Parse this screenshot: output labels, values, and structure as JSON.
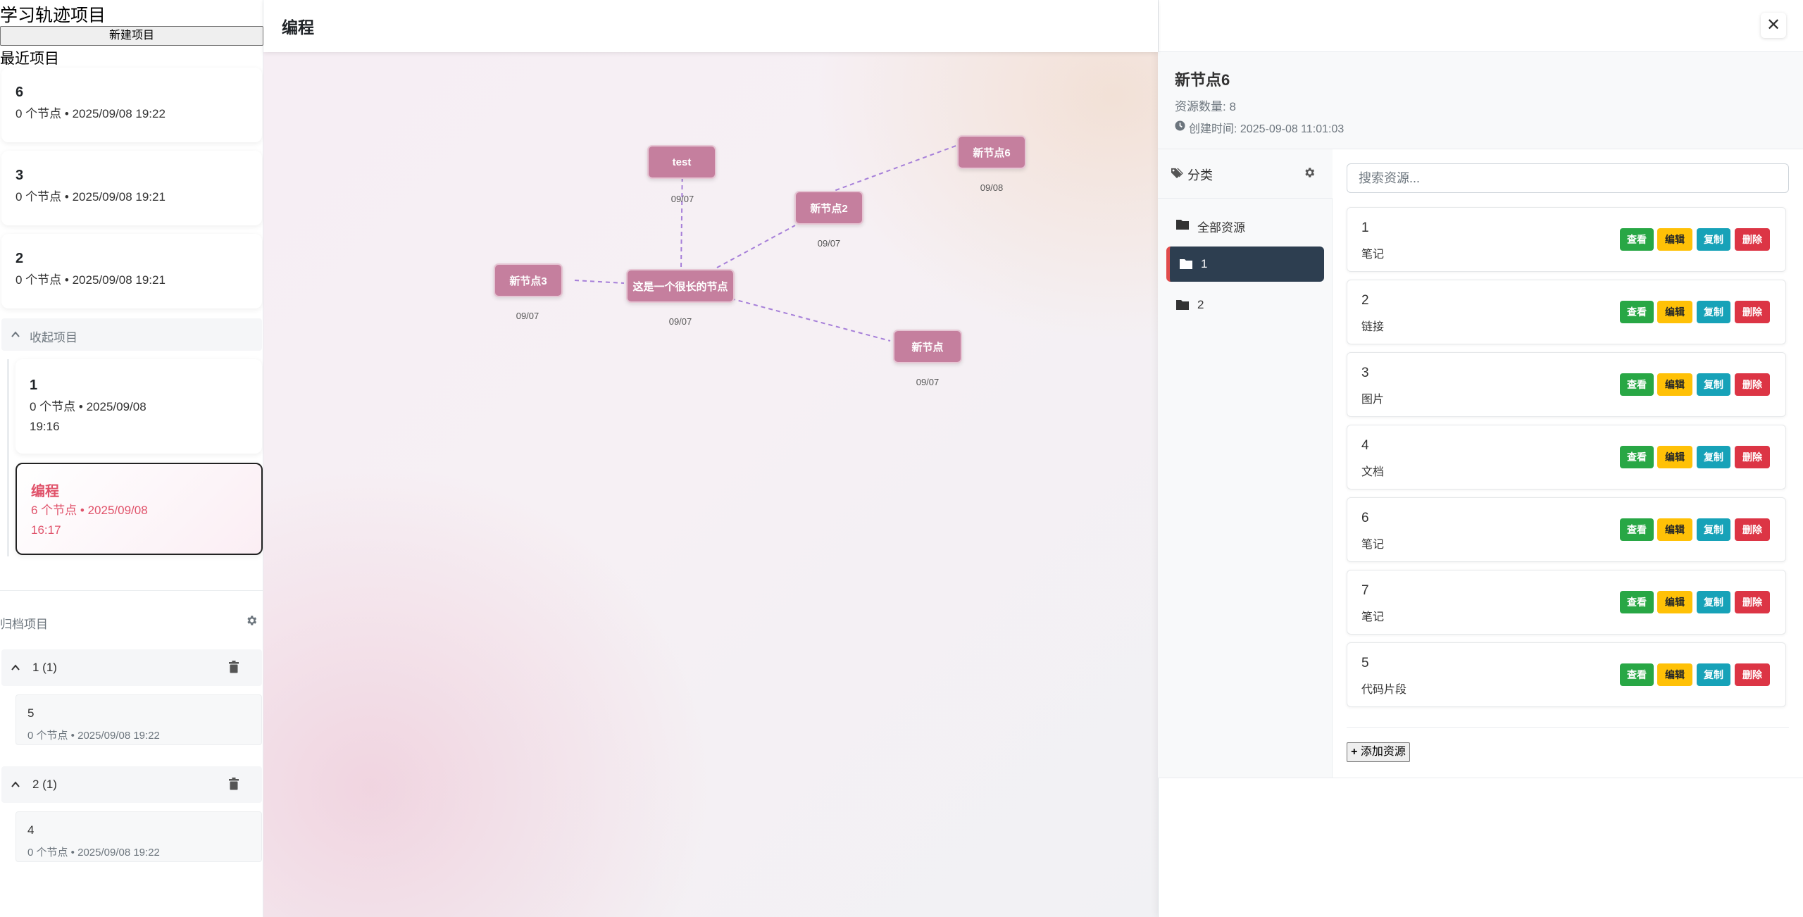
{
  "sidebar": {
    "app_title": "学习轨迹项目",
    "new_project_label": "新建项目",
    "recent_title": "最近项目",
    "recent": [
      {
        "name": "6",
        "meta": "0 个节点 • 2025/09/08 19:22"
      },
      {
        "name": "3",
        "meta": "0 个节点 • 2025/09/08 19:21"
      },
      {
        "name": "2",
        "meta": "0 个节点 • 2025/09/08 19:21"
      }
    ],
    "collapse_label": "收起项目",
    "more": [
      {
        "name": "1",
        "meta_line1": "0 个节点 • 2025/09/08",
        "meta_line2": "19:16"
      },
      {
        "name": "编程",
        "meta_line1": "6 个节点 • 2025/09/08",
        "meta_line2": "16:17"
      }
    ],
    "archive_title": "归档项目",
    "archive_groups": [
      {
        "label": "1 (1)",
        "item": {
          "name": "5",
          "meta": "0 个节点 • 2025/09/08 19:22"
        }
      },
      {
        "label": "2 (1)",
        "item": {
          "name": "4",
          "meta": "0 个节点 • 2025/09/08 19:22"
        }
      }
    ]
  },
  "main": {
    "title": "编程",
    "nodes": [
      {
        "label": "test",
        "date": "09/07"
      },
      {
        "label": "新节点6",
        "date": "09/08"
      },
      {
        "label": "新节点2",
        "date": "09/07"
      },
      {
        "label": "新节点3",
        "date": "09/07"
      },
      {
        "label": "这是一个很长的节点",
        "date": "09/07"
      },
      {
        "label": "新节点",
        "date": "09/07"
      }
    ]
  },
  "panel": {
    "node_title": "新节点6",
    "resource_count": "资源数量: 8",
    "created_at": "创建时间: 2025-09-08 11:01:03",
    "category_header": "分类",
    "categories": [
      "全部资源",
      "1",
      "2"
    ],
    "search_placeholder": "搜索资源...",
    "buttons": {
      "view": "查看",
      "edit": "编辑",
      "copy": "复制",
      "delete": "删除"
    },
    "resources": [
      {
        "name": "1",
        "type": "笔记"
      },
      {
        "name": "2",
        "type": "链接"
      },
      {
        "name": "3",
        "type": "图片"
      },
      {
        "name": "4",
        "type": "文档"
      },
      {
        "name": "6",
        "type": "笔记"
      },
      {
        "name": "7",
        "type": "笔记"
      },
      {
        "name": "5",
        "type": "代码片段"
      }
    ],
    "add_resource_label": "添加资源",
    "close_glyph": "✕"
  }
}
